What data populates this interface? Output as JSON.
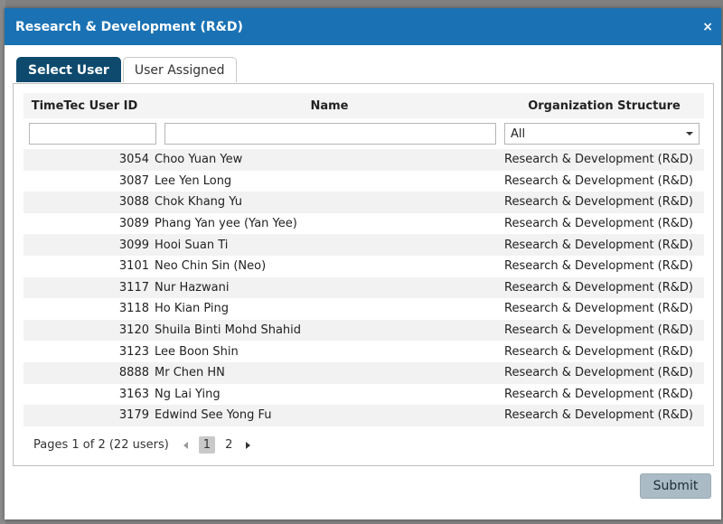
{
  "dialog": {
    "title": "Research & Development (R&D)",
    "close_glyph": "×"
  },
  "tabs": [
    {
      "label": "Select User",
      "active": true
    },
    {
      "label": "User Assigned",
      "active": false
    }
  ],
  "table": {
    "headers": {
      "id": "TimeTec User ID",
      "name": "Name",
      "org": "Organization Structure"
    },
    "filters": {
      "id_value": "",
      "name_value": "",
      "org_selected": "All"
    },
    "rows": [
      {
        "id": "3054",
        "name": "Choo Yuan Yew",
        "org": "Research & Development (R&D)"
      },
      {
        "id": "3087",
        "name": "Lee Yen Long",
        "org": "Research & Development (R&D)"
      },
      {
        "id": "3088",
        "name": "Chok Khang Yu",
        "org": "Research & Development (R&D)"
      },
      {
        "id": "3089",
        "name": "Phang Yan yee (Yan Yee)",
        "org": "Research & Development (R&D)"
      },
      {
        "id": "3099",
        "name": "Hooi Suan Ti",
        "org": "Research & Development (R&D)"
      },
      {
        "id": "3101",
        "name": "Neo Chin Sin (Neo)",
        "org": "Research & Development (R&D)"
      },
      {
        "id": "3117",
        "name": "Nur Hazwani",
        "org": "Research & Development (R&D)"
      },
      {
        "id": "3118",
        "name": "Ho Kian Ping",
        "org": "Research & Development (R&D)"
      },
      {
        "id": "3120",
        "name": "Shuila Binti Mohd Shahid",
        "org": "Research & Development (R&D)"
      },
      {
        "id": "3123",
        "name": "Lee Boon Shin",
        "org": "Research & Development (R&D)"
      },
      {
        "id": "8888",
        "name": "Mr Chen HN",
        "org": "Research & Development (R&D)"
      },
      {
        "id": "3163",
        "name": "Ng Lai Ying",
        "org": "Research & Development (R&D)"
      },
      {
        "id": "3179",
        "name": "Edwind See Yong Fu",
        "org": "Research & Development (R&D)"
      }
    ]
  },
  "pager": {
    "summary": "Pages 1 of 2 (22 users)",
    "pages": [
      "1",
      "2"
    ],
    "current": "1"
  },
  "footer": {
    "submit_label": "Submit"
  },
  "colors": {
    "header_bg": "#1a72b4",
    "active_tab_bg": "#0e4a6e",
    "submit_bg": "#aabbc6"
  }
}
